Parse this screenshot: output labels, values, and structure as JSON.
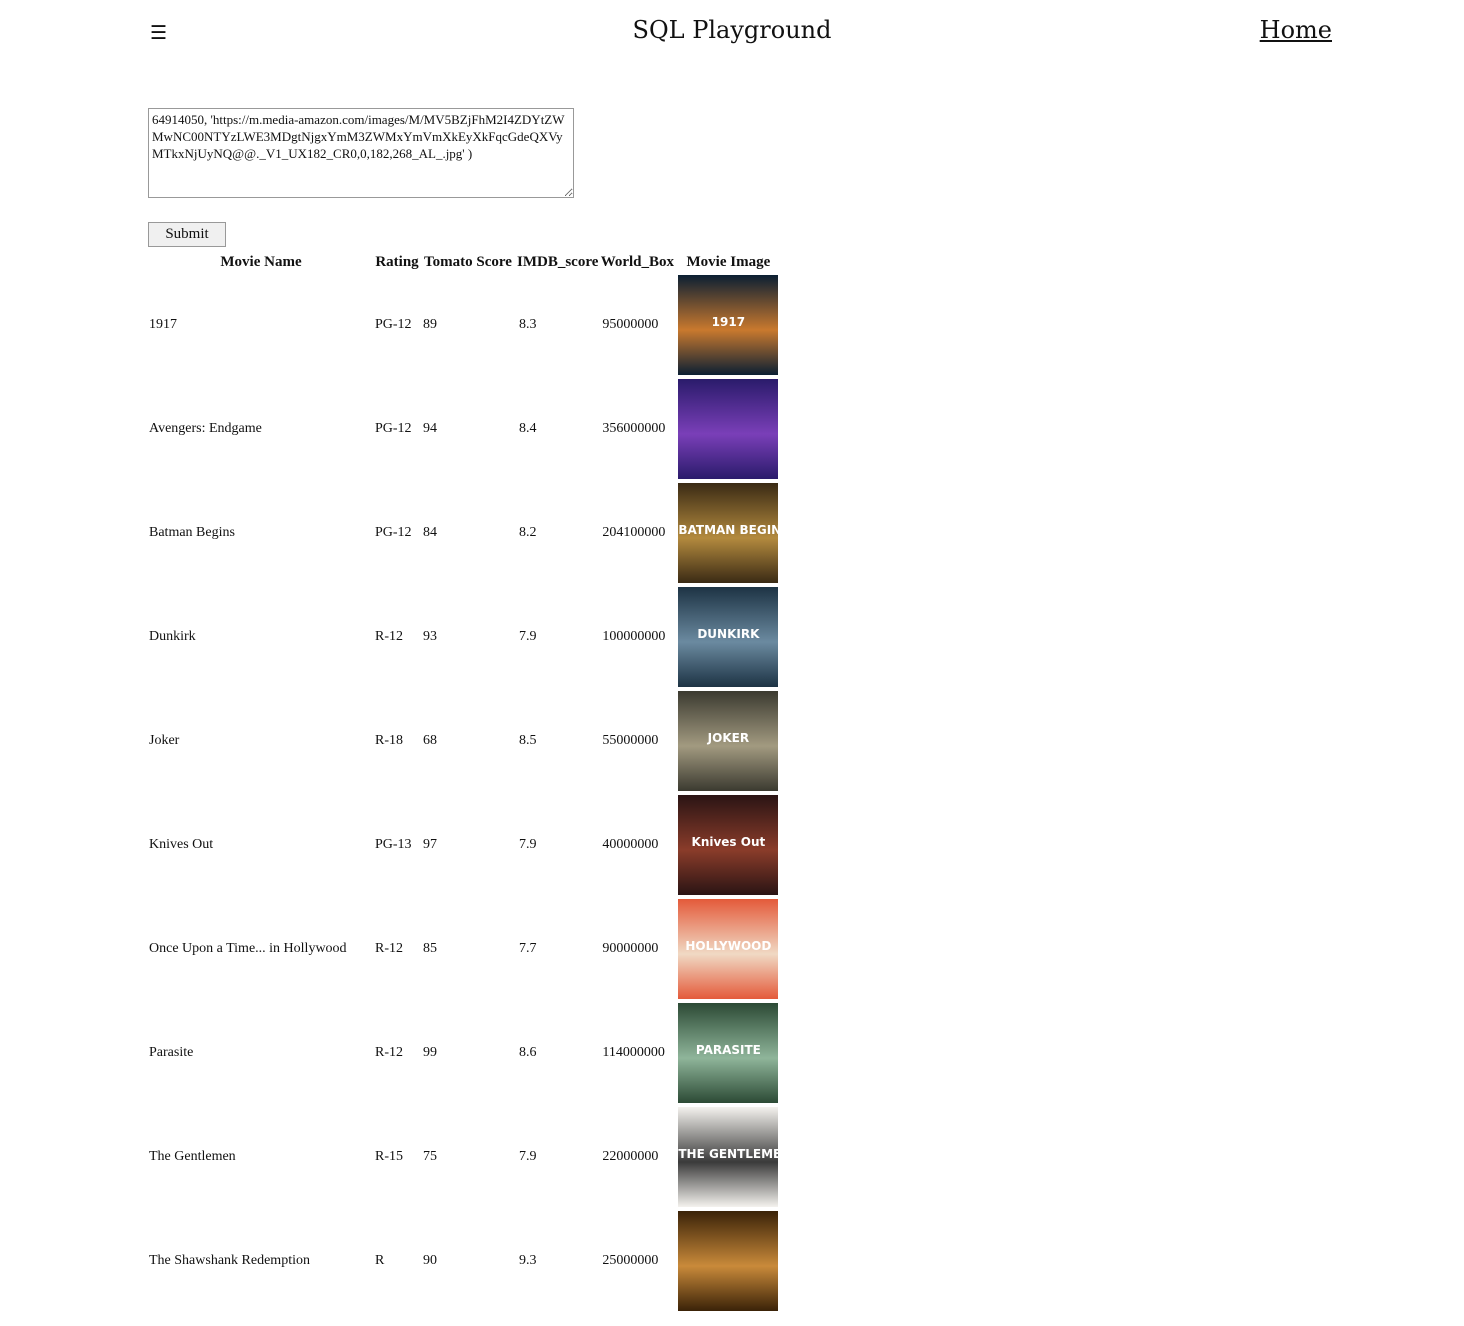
{
  "header": {
    "menu_icon": "☰",
    "title": "SQL Playground",
    "home_link": "Home"
  },
  "query": {
    "value": "64914050, 'https://m.media-amazon.com/images/M/MV5BZjFhM2I4ZDYtZWMwNC00NTYzLWE3MDgtNjgxYmM3ZWMxYmVmXkEyXkFqcGdeQXVyMTkxNjUyNQ@@._V1_UX182_CR0,0,182,268_AL_.jpg' )",
    "submit_label": "Submit"
  },
  "table": {
    "headers": [
      "Movie Name",
      "Rating",
      "Tomato Score",
      "IMDB_score",
      "World_Box",
      "Movie Image"
    ],
    "rows": [
      {
        "name": "1917",
        "rating": "PG-12",
        "tomato": "89",
        "imdb": "8.3",
        "box": "95000000",
        "poster_text": "1917",
        "poster_colors": [
          "#0b1f33",
          "#c9792e"
        ]
      },
      {
        "name": "Avengers: Endgame",
        "rating": "PG-12",
        "tomato": "94",
        "imdb": "8.4",
        "box": "356000000",
        "poster_text": "",
        "poster_colors": [
          "#2a1b6b",
          "#7a3fb8"
        ]
      },
      {
        "name": "Batman Begins",
        "rating": "PG-12",
        "tomato": "84",
        "imdb": "8.2",
        "box": "204100000",
        "poster_text": "BATMAN BEGINS",
        "poster_colors": [
          "#3a2a14",
          "#b38a3e"
        ]
      },
      {
        "name": "Dunkirk",
        "rating": "R-12",
        "tomato": "93",
        "imdb": "7.9",
        "box": "100000000",
        "poster_text": "DUNKIRK",
        "poster_colors": [
          "#1d3344",
          "#6b8aa0"
        ]
      },
      {
        "name": "Joker",
        "rating": "R-18",
        "tomato": "68",
        "imdb": "8.5",
        "box": "55000000",
        "poster_text": "JOKER",
        "poster_colors": [
          "#3b3a30",
          "#a29a80"
        ]
      },
      {
        "name": "Knives Out",
        "rating": "PG-13",
        "tomato": "97",
        "imdb": "7.9",
        "box": "40000000",
        "poster_text": "Knives Out",
        "poster_colors": [
          "#2a1414",
          "#8a3c2a"
        ]
      },
      {
        "name": "Once Upon a Time... in Hollywood",
        "rating": "R-12",
        "tomato": "85",
        "imdb": "7.7",
        "box": "90000000",
        "poster_text": "HOLLYWOOD",
        "poster_colors": [
          "#e45a3a",
          "#f0d9c4"
        ]
      },
      {
        "name": "Parasite",
        "rating": "R-12",
        "tomato": "99",
        "imdb": "8.6",
        "box": "114000000",
        "poster_text": "PARASITE",
        "poster_colors": [
          "#2c4a35",
          "#8fb59a"
        ]
      },
      {
        "name": "The Gentlemen",
        "rating": "R-15",
        "tomato": "75",
        "imdb": "7.9",
        "box": "22000000",
        "poster_text": "THE GENTLEMEN",
        "poster_colors": [
          "#f4f2ee",
          "#3a3a3a"
        ]
      },
      {
        "name": "The Shawshank Redemption",
        "rating": "R",
        "tomato": "90",
        "imdb": "9.3",
        "box": "25000000",
        "poster_text": "",
        "poster_colors": [
          "#3a2208",
          "#c98a3a"
        ]
      }
    ]
  }
}
